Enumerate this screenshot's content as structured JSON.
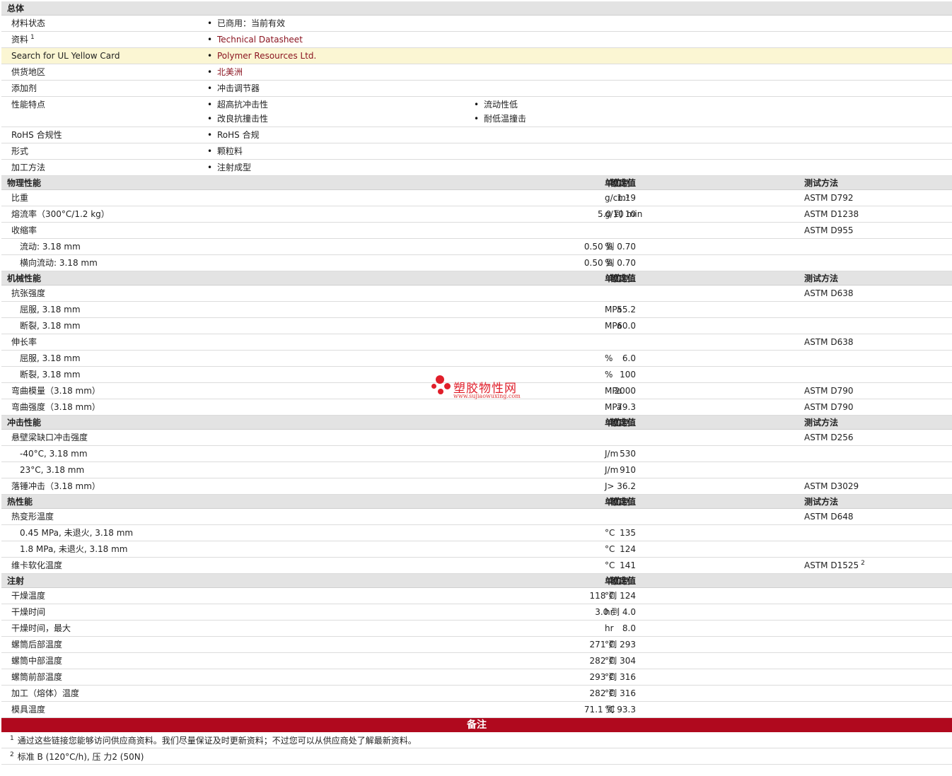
{
  "general": {
    "header": "总体",
    "rows": [
      {
        "label": "材料状态",
        "items": [
          "已商用：当前有效"
        ],
        "link": false
      },
      {
        "label": "资料",
        "label_sup": "1",
        "items": [
          "Technical Datasheet"
        ],
        "link": true
      },
      {
        "label": "Search for UL Yellow Card",
        "items": [
          "Polymer Resources Ltd."
        ],
        "link": true,
        "highlight": true
      },
      {
        "label": "供货地区",
        "items": [
          "北美洲"
        ],
        "link": true
      },
      {
        "label": "添加剂",
        "items": [
          "冲击调节器"
        ],
        "link": false
      },
      {
        "label": "性能特点",
        "items": [
          "超高抗冲击性",
          "流动性低",
          "改良抗撞击性",
          "耐低温撞击"
        ],
        "link": false
      },
      {
        "label": "RoHS 合规性",
        "items": [
          "RoHS 合规"
        ],
        "link": false
      },
      {
        "label": "形式",
        "items": [
          "颗粒料"
        ],
        "link": false
      },
      {
        "label": "加工方法",
        "items": [
          "注射成型"
        ],
        "link": false
      }
    ]
  },
  "column_labels": {
    "nominal": "额定值",
    "unit": "单位制",
    "test": "测试方法"
  },
  "sections": [
    {
      "title": "物理性能",
      "show_test": true,
      "rows": [
        {
          "label": "比重",
          "value": "1.19",
          "unit": "g/cm³",
          "test": "ASTM D792"
        },
        {
          "label": "熔流率（300°C/1.2 kg）",
          "value": "5.0 到  10",
          "unit": "g/10 min",
          "test": "ASTM D1238"
        },
        {
          "label": "收缩率",
          "value": "",
          "unit": "",
          "test": "ASTM D955"
        },
        {
          "label": "流动: 3.18 mm",
          "sub": true,
          "value": "0.50 到  0.70",
          "unit": "%",
          "test": ""
        },
        {
          "label": "横向流动: 3.18 mm",
          "sub": true,
          "value": "0.50 到  0.70",
          "unit": "%",
          "test": ""
        }
      ]
    },
    {
      "title": "机械性能",
      "show_test": true,
      "rows": [
        {
          "label": "抗张强度",
          "value": "",
          "unit": "",
          "test": "ASTM D638"
        },
        {
          "label": "屈服, 3.18 mm",
          "sub": true,
          "value": "55.2",
          "unit": "MPa",
          "test": ""
        },
        {
          "label": "断裂, 3.18 mm",
          "sub": true,
          "value": "60.0",
          "unit": "MPa",
          "test": ""
        },
        {
          "label": "伸长率",
          "value": "",
          "unit": "",
          "test": "ASTM D638"
        },
        {
          "label": "屈服, 3.18 mm",
          "sub": true,
          "value": "6.0",
          "unit": "%",
          "test": ""
        },
        {
          "label": "断裂, 3.18 mm",
          "sub": true,
          "value": "100",
          "unit": "%",
          "test": ""
        },
        {
          "label": "弯曲模量（3.18 mm）",
          "value": "2000",
          "unit": "MPa",
          "test": "ASTM D790"
        },
        {
          "label": "弯曲强度（3.18 mm）",
          "value": "79.3",
          "unit": "MPa",
          "test": "ASTM D790"
        }
      ]
    },
    {
      "title": "冲击性能",
      "show_test": true,
      "rows": [
        {
          "label": "悬壁梁缺口冲击强度",
          "value": "",
          "unit": "",
          "test": "ASTM D256"
        },
        {
          "label": "-40°C, 3.18 mm",
          "sub": true,
          "value": "530",
          "unit": "J/m",
          "test": ""
        },
        {
          "label": "23°C, 3.18 mm",
          "sub": true,
          "value": "910",
          "unit": "J/m",
          "test": ""
        },
        {
          "label": "落锤冲击（3.18 mm）",
          "value": "> 36.2",
          "unit": "J",
          "test": "ASTM D3029"
        }
      ]
    },
    {
      "title": "热性能",
      "show_test": true,
      "rows": [
        {
          "label": "热变形温度",
          "value": "",
          "unit": "",
          "test": "ASTM D648"
        },
        {
          "label": "0.45 MPa, 未退火, 3.18 mm",
          "sub": true,
          "value": "135",
          "unit": "°C",
          "test": ""
        },
        {
          "label": "1.8 MPa, 未退火, 3.18 mm",
          "sub": true,
          "value": "124",
          "unit": "°C",
          "test": ""
        },
        {
          "label": "维卡软化温度",
          "value": "141",
          "unit": "°C",
          "test": "ASTM D1525",
          "test_sup": "2"
        }
      ]
    },
    {
      "title": "注射",
      "show_test": false,
      "rows": [
        {
          "label": "干燥温度",
          "value": "118 到  124",
          "unit": "°C",
          "test": ""
        },
        {
          "label": "干燥时间",
          "value": "3.0 到  4.0",
          "unit": "hr",
          "test": ""
        },
        {
          "label": "干燥时间，最大",
          "value": "8.0",
          "unit": "hr",
          "test": ""
        },
        {
          "label": "螺筒后部温度",
          "value": "271 到  293",
          "unit": "°C",
          "test": ""
        },
        {
          "label": "螺筒中部温度",
          "value": "282 到  304",
          "unit": "°C",
          "test": ""
        },
        {
          "label": "螺筒前部温度",
          "value": "293 到  316",
          "unit": "°C",
          "test": ""
        },
        {
          "label": "加工（熔体）温度",
          "value": "282 到  316",
          "unit": "°C",
          "test": ""
        },
        {
          "label": "模具温度",
          "value": "71.1 到  93.3",
          "unit": "°C",
          "test": ""
        }
      ]
    }
  ],
  "notes": {
    "header": "备注",
    "items": [
      {
        "num": "1",
        "text": "通过这些链接您能够访问供应商资料。我们尽量保证及时更新资料；不过您可以从供应商处了解最新资料。"
      },
      {
        "num": "2",
        "text": "标准  B (120°C/h), 压  力2 (50N)"
      }
    ]
  },
  "watermark": {
    "brand": "塑胶物性网",
    "url": "www.sujiaowuxing.com",
    "color": "#e01e2a"
  },
  "colors": {
    "section_bg": "#e3e3e3",
    "link": "#8b1521",
    "highlight": "#fbf6d3",
    "notes_bar": "#b0091e"
  }
}
